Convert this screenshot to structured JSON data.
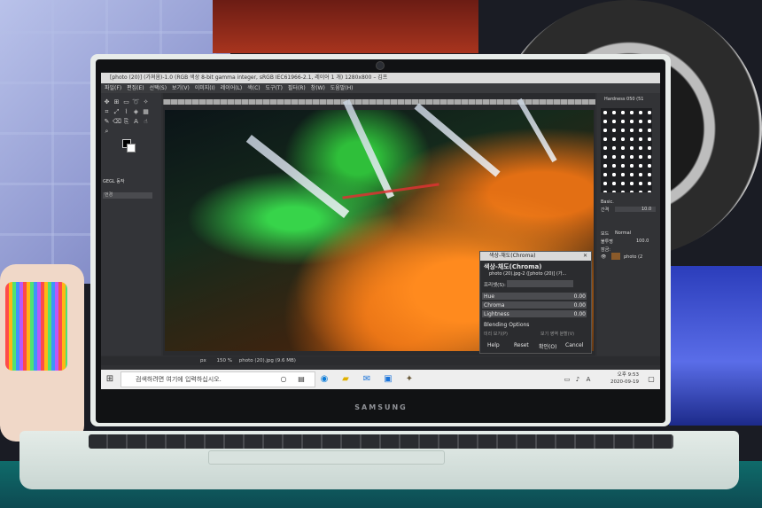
{
  "gimp": {
    "window_title": "[photo (20)] (가져옴)-1.0 (RGB 색상 8-bit gamma integer, sRGB IEC61966-2.1, 레이어 1 개) 1280x800 – 김프",
    "menu": [
      "파일(F)",
      "편집(E)",
      "선택(S)",
      "보기(V)",
      "이미지(I)",
      "레이어(L)",
      "색(C)",
      "도구(T)",
      "필터(R)",
      "창(W)",
      "도움말(H)"
    ],
    "tool_options_title": "GEGL 동작",
    "tool_options_field": "번경",
    "brushes_title": "Hardness 050 (51",
    "brush_preset": "Basic.",
    "spacing_label": "간격",
    "spacing_value": "10.0",
    "mode_label": "모드",
    "mode_value": "Normal",
    "opacity_label": "불투명",
    "opacity_value": "100.0",
    "lock_label": "잠금:",
    "layer_name": "photo (2",
    "status_unit": "px",
    "status_zoom": "150 %",
    "status_file": "photo (20).jpg (9.6 MB)"
  },
  "dialog": {
    "title": "색상-채도(Chroma)",
    "heading": "색상-채도(Chroma)",
    "subtitle": "photo (20).jpg-2 ([photo (20)] (가...",
    "preset_label": "프리셋(S):",
    "fields": [
      {
        "label": "Hue",
        "value": "0.00"
      },
      {
        "label": "Chroma",
        "value": "0.00"
      },
      {
        "label": "Lightness",
        "value": "0.00"
      }
    ],
    "blending": "Blending Options",
    "preview": "미리 보기(P)",
    "split": "보기 영역 분할(V)",
    "buttons": [
      "Help",
      "Reset",
      "확인(O)",
      "Cancel"
    ]
  },
  "taskbar": {
    "search_placeholder": "검색하려면 여기에 입력하십시오.",
    "time": "오후 9:53",
    "date": "2020-09-19"
  },
  "laptop_brand": "SAMSUNG"
}
